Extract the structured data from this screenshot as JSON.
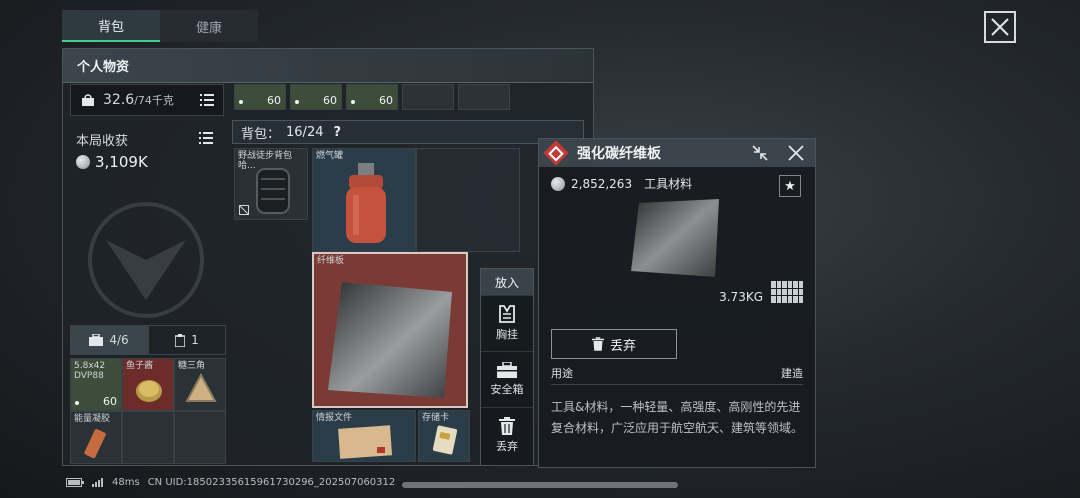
{
  "tabs": [
    {
      "label": "背包"
    },
    {
      "label": "健康"
    }
  ],
  "panel": {
    "title": "个人物资"
  },
  "weight": {
    "value": "32.6",
    "max": "/74千克"
  },
  "income": {
    "label": "本局收获",
    "value": "3,109K"
  },
  "bottom_tabs": [
    {
      "label": "4/6"
    },
    {
      "label": "1"
    }
  ],
  "pocket_items": [
    {
      "name": "5.8x42 DVP88",
      "qty": "60"
    },
    {
      "name": "鱼子酱",
      "qty": ""
    },
    {
      "name": "糖三角",
      "qty": ""
    },
    {
      "name": "能量凝胶",
      "qty": ""
    }
  ],
  "top_strip": [
    {
      "qty": "60"
    },
    {
      "qty": "60"
    },
    {
      "qty": "60"
    }
  ],
  "bag": {
    "label": "背包：",
    "count": "16/24",
    "help": "?"
  },
  "bag_items": [
    {
      "name": "野战徒步背包 哈..."
    },
    {
      "name": "燃气罐"
    },
    {
      "name": "纤维板"
    },
    {
      "name": "情报文件"
    },
    {
      "name": "存储卡"
    }
  ],
  "context_menu": {
    "header": "放入",
    "items": [
      {
        "label": "胸挂"
      },
      {
        "label": "安全箱"
      },
      {
        "label": "丢弃"
      }
    ]
  },
  "detail": {
    "title": "强化碳纤维板",
    "price": "2,852,263",
    "category": "工具材料",
    "weight": "3.73KG",
    "discard_label": "丢弃",
    "use_label": "用途",
    "build_label": "建造",
    "description": "工具&材料，一种轻量、高强度、高刚性的先进复合材料，广泛应用于航空航天、建筑等领域。"
  },
  "status": {
    "ping": "48ms",
    "uid": "CN UID:18502335615961730296_202507060312"
  },
  "colors": {
    "accent": "#3fd08f",
    "danger": "#c23a35",
    "selected_cell": "#7a3b36"
  }
}
